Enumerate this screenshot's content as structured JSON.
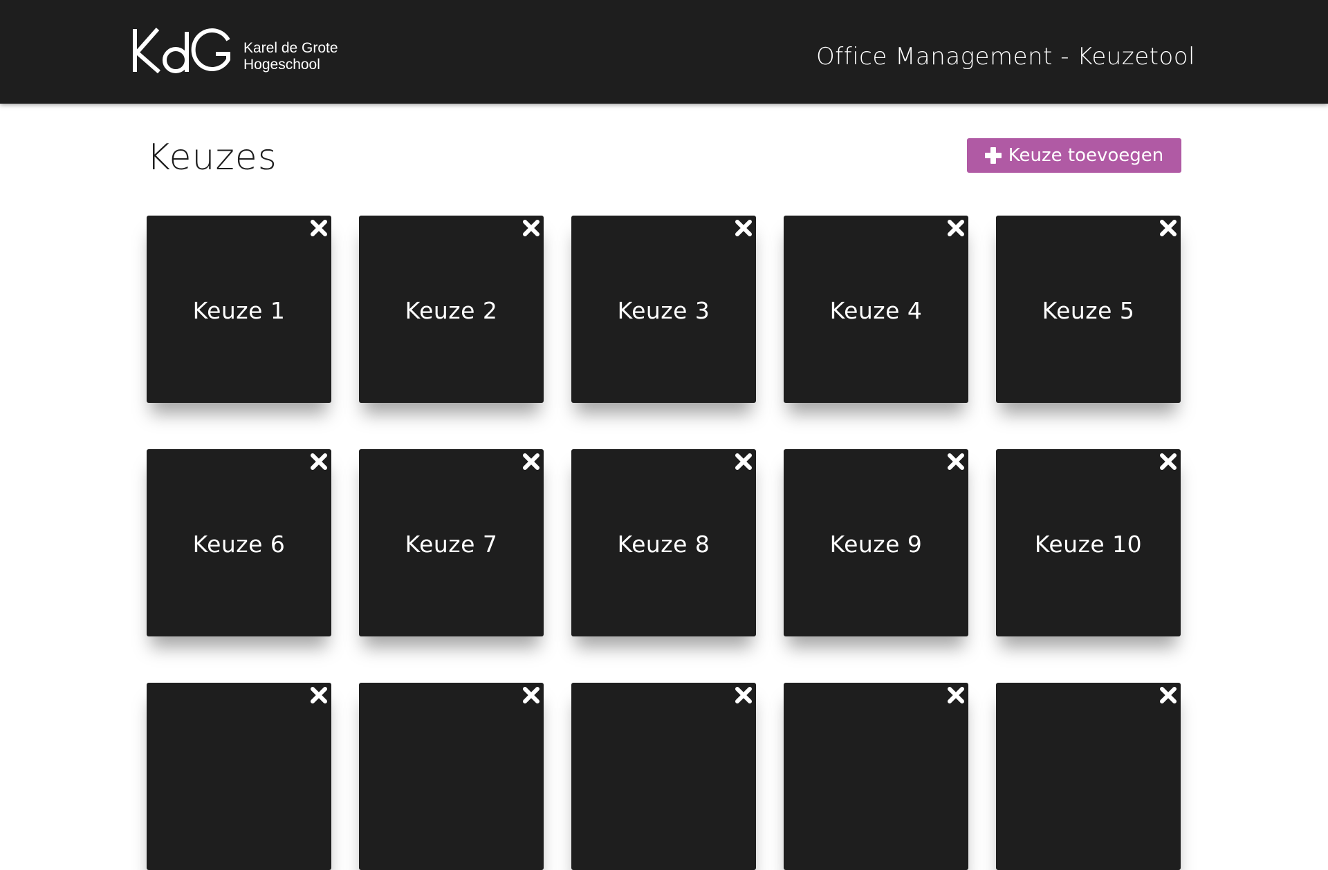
{
  "header": {
    "logo_mark": "KdG",
    "logo_line1": "Karel de Grote",
    "logo_line2": "Hogeschool",
    "app_title": "Office Management - Keuzetool",
    "background_color": "#1e1e1e"
  },
  "main": {
    "title": "Keuzes",
    "add_button": {
      "label": "Keuze toevoegen",
      "icon": "plus-icon",
      "color": "#b05aa4"
    },
    "cards": [
      {
        "label": "Keuze 1"
      },
      {
        "label": "Keuze 2"
      },
      {
        "label": "Keuze 3"
      },
      {
        "label": "Keuze 4"
      },
      {
        "label": "Keuze 5"
      },
      {
        "label": "Keuze 6"
      },
      {
        "label": "Keuze 7"
      },
      {
        "label": "Keuze 8"
      },
      {
        "label": "Keuze 9"
      },
      {
        "label": "Keuze 10"
      },
      {
        "label": ""
      },
      {
        "label": ""
      },
      {
        "label": ""
      },
      {
        "label": ""
      },
      {
        "label": ""
      }
    ],
    "card_icon": "close-icon"
  }
}
